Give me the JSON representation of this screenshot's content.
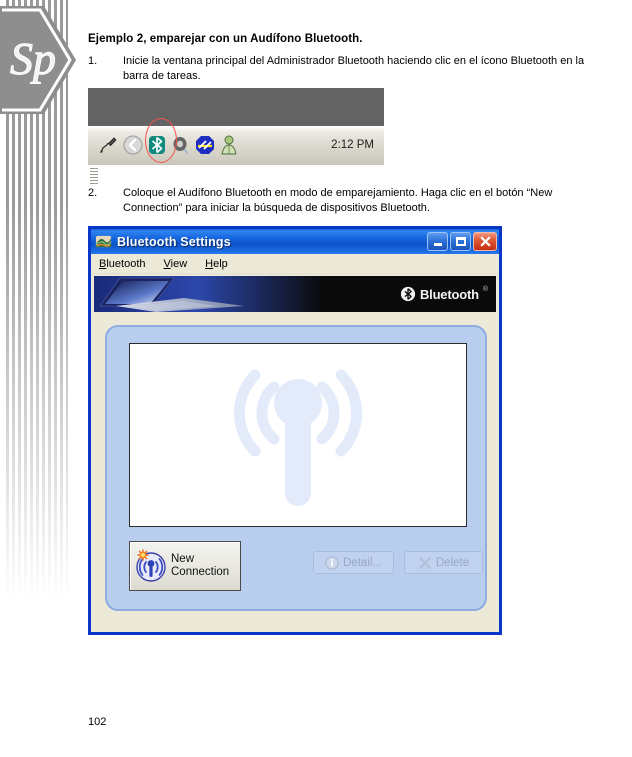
{
  "document": {
    "heading": "Ejemplo 2, emparejar con un Audífono Bluetooth.",
    "steps": [
      {
        "number": "1.",
        "text": "Inicie la ventana principal del Administrador Bluetooth haciendo clic en el ícono Bluetooth en la barra de tareas."
      },
      {
        "number": "2.",
        "text": "Coloque el Audífono Bluetooth en modo de emparejamiento. Haga clic en el botón “New Connection” para iniciar la búsqueda de dispositivos Bluetooth."
      }
    ],
    "page_number": "102",
    "logo_text": "Sp"
  },
  "taskbar_figure": {
    "clock": "2:12 PM",
    "tray_icons": [
      "pen-tablet-icon",
      "show-hidden-icons-chevron-icon",
      "bluetooth-icon",
      "volume-icon",
      "network-activity-icon",
      "user-account-icon"
    ],
    "annotation": "red-ellipse-highlight-bluetooth-icon",
    "colors": {
      "desktop": "#636363",
      "taskbar": "#dcd9cf",
      "bluetooth_teal": "#108a7e",
      "annotation_red": "#f4524a"
    }
  },
  "bluetooth_window": {
    "title": "Bluetooth Settings",
    "title_icon": "bluetooth-settings-app-icon",
    "window_buttons": {
      "minimize": "minimize-button",
      "maximize": "maximize-button",
      "close": "close-button"
    },
    "menu": [
      {
        "label": "Bluetooth",
        "accesskey": "B"
      },
      {
        "label": "View",
        "accesskey": "V"
      },
      {
        "label": "Help",
        "accesskey": "H"
      }
    ],
    "banner": {
      "brand": "Bluetooth",
      "registered_mark": "®",
      "graphic": "laptop-photo"
    },
    "device_list": {
      "items": [],
      "watermark": "antenna-broadcast-watermark"
    },
    "buttons": [
      {
        "name": "new-connection",
        "label_line1": "New",
        "label_line2": "Connection",
        "enabled": true,
        "icon": "antenna-new-connection-icon"
      },
      {
        "name": "detail",
        "label": "Detail...",
        "enabled": false,
        "icon": "info-icon"
      },
      {
        "name": "delete",
        "label": "Delete",
        "enabled": false,
        "icon": "x-delete-icon"
      }
    ],
    "colors": {
      "titlebar_blue": "#1565e0",
      "window_border": "#0b37c9",
      "panel_blue": "#b9cdee",
      "chrome_beige": "#ece9d8",
      "close_red": "#c42e12"
    }
  }
}
